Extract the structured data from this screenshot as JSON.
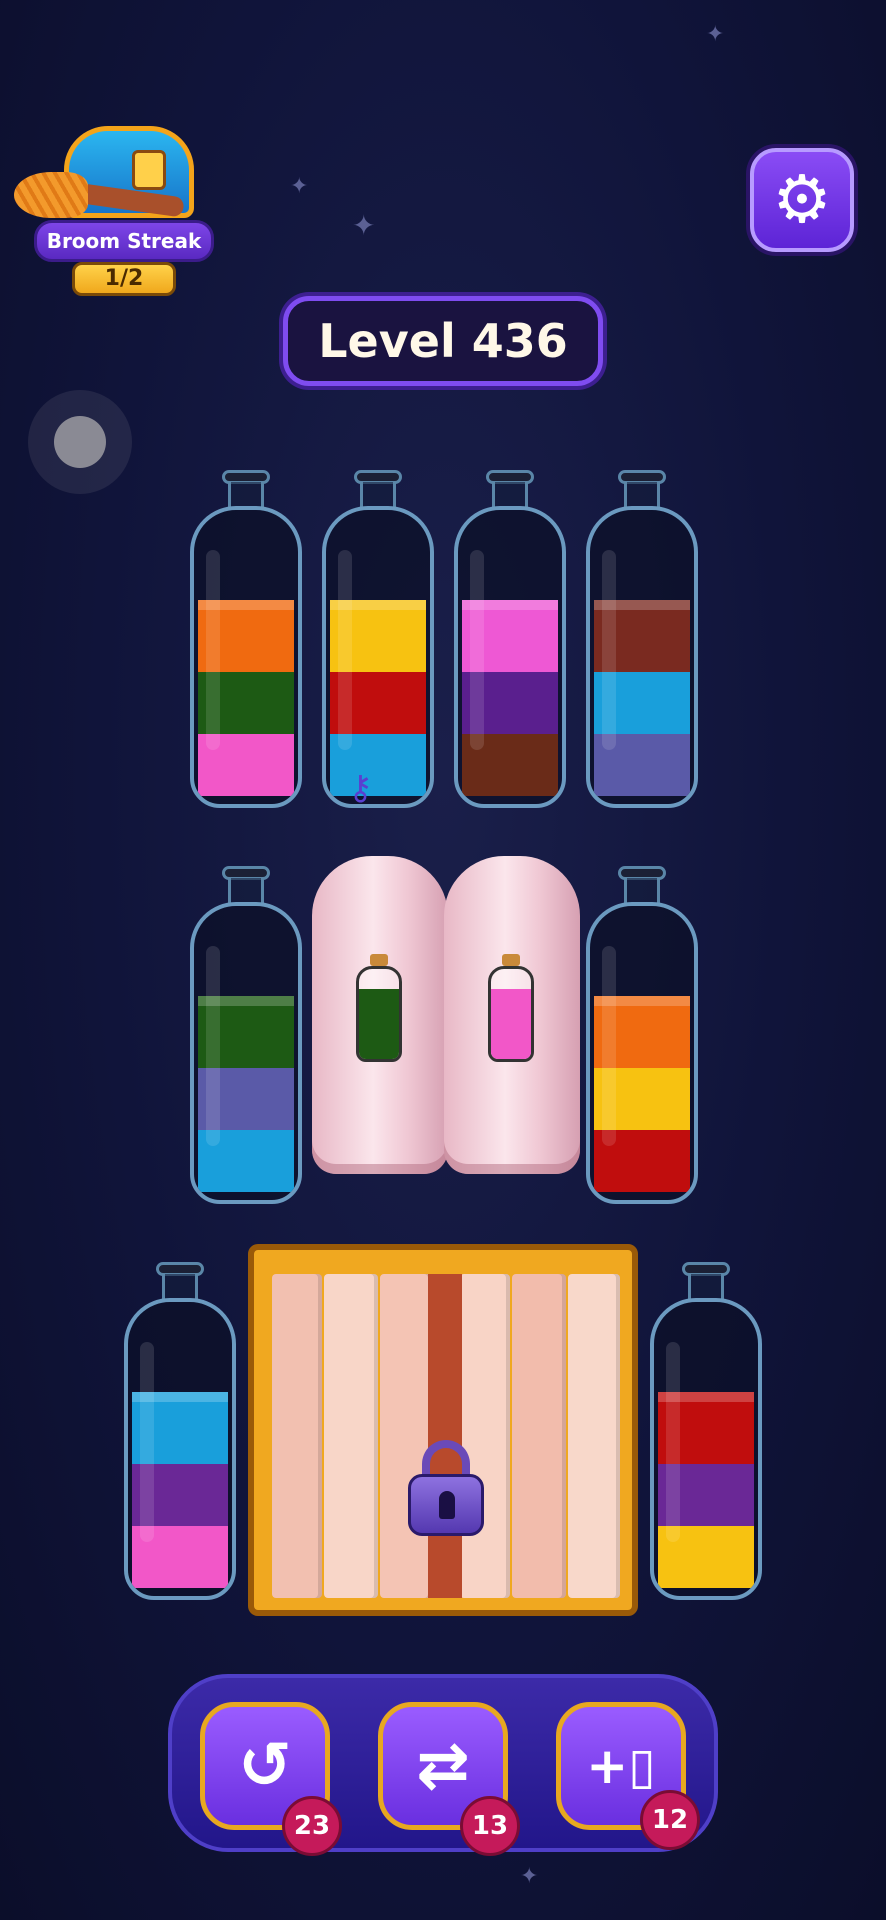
{
  "level": {
    "label": "Level 436"
  },
  "broom_streak": {
    "title": "Broom Streak",
    "progress": "1/2"
  },
  "settings": {
    "icon": "gear-icon"
  },
  "colors": {
    "orange": "#f06a10",
    "green": "#1d5a14",
    "pink": "#f257c8",
    "yellow": "#f7c211",
    "red": "#c00d0d",
    "lightblue": "#199fdb",
    "magenta": "#ee58d4",
    "purple": "#5a1f8e",
    "brown": "#6a2b18",
    "rust": "#7a2a20",
    "slate": "#5a5aa8",
    "violet": "#6a2896"
  },
  "bottles": [
    {
      "id": "b1",
      "layers_top_to_bottom": [
        "orange",
        "green",
        "pink"
      ]
    },
    {
      "id": "b2",
      "layers_top_to_bottom": [
        "yellow",
        "red",
        "lightblue"
      ],
      "contains": "key-icon"
    },
    {
      "id": "b3",
      "layers_top_to_bottom": [
        "magenta",
        "purple",
        "brown"
      ]
    },
    {
      "id": "b4",
      "layers_top_to_bottom": [
        "rust",
        "lightblue",
        "slate"
      ]
    },
    {
      "id": "b5",
      "layers_top_to_bottom": [
        "green",
        "slate",
        "lightblue"
      ]
    },
    {
      "id": "b6",
      "covered": true,
      "hint_color": "green"
    },
    {
      "id": "b7",
      "covered": true,
      "hint_color": "pink"
    },
    {
      "id": "b8",
      "layers_top_to_bottom": [
        "orange",
        "yellow",
        "red"
      ]
    },
    {
      "id": "b9",
      "layers_top_to_bottom": [
        "lightblue",
        "violet",
        "pink"
      ]
    },
    {
      "id": "b10",
      "locked": true,
      "icon": "padlock-icon"
    },
    {
      "id": "b11",
      "layers_top_to_bottom": [
        "red",
        "violet",
        "yellow"
      ]
    }
  ],
  "tools": [
    {
      "name": "undo",
      "icon": "undo-icon",
      "count": "23"
    },
    {
      "name": "shuffle",
      "icon": "shuffle-icon",
      "count": "13"
    },
    {
      "name": "add-bottle",
      "icon": "add-bottle-icon",
      "count": "12"
    }
  ]
}
